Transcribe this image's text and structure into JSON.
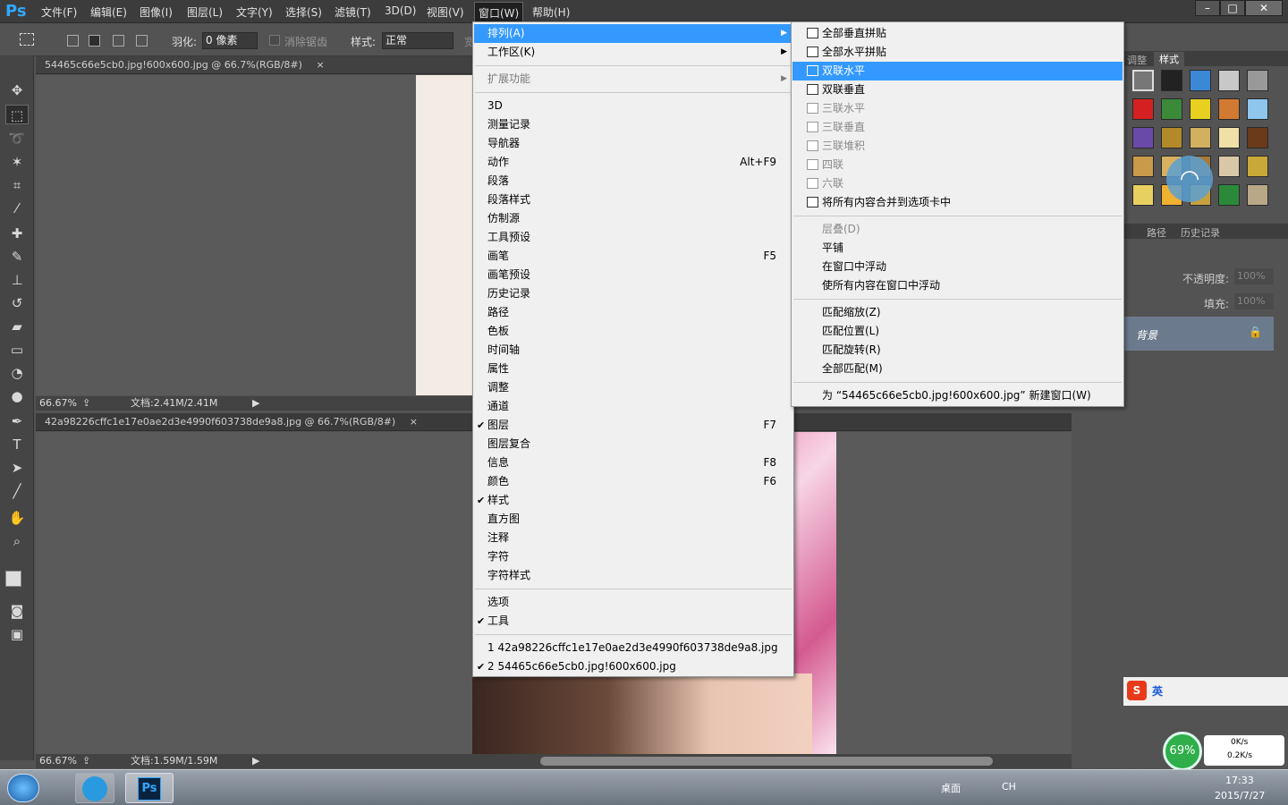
{
  "app": {
    "logo": "Ps"
  },
  "menubar": {
    "items": [
      "文件(F)",
      "编辑(E)",
      "图像(I)",
      "图层(L)",
      "文字(Y)",
      "选择(S)",
      "滤镜(T)",
      "3D(D)",
      "视图(V)",
      "窗口(W)",
      "帮助(H)"
    ],
    "active_index": 9,
    "window_buttons": [
      "–",
      "□",
      "✕"
    ]
  },
  "options": {
    "feather_label": "羽化:",
    "feather_value": "0 像素",
    "antialias_label": "消除锯齿",
    "style_label": "样式:",
    "style_value": "正常",
    "truncated": "宽"
  },
  "doc1": {
    "tab": "54465c66e5cb0.jpg!600x600.jpg @ 66.7%(RGB/8#)",
    "zoom": "66.67%",
    "doc_size": "文档:2.41M/2.41M"
  },
  "doc2": {
    "tab": "42a98226cffc1e17e0ae2d3e4990f603738de9a8.jpg @ 66.7%(RGB/8#)",
    "zoom": "66.67%",
    "doc_size": "文档:1.59M/1.59M"
  },
  "window_menu": [
    {
      "label": "排列(A)",
      "submenu": true,
      "highlight": true
    },
    {
      "label": "工作区(K)",
      "submenu": true
    },
    {
      "sep": true
    },
    {
      "label": "扩展功能",
      "submenu": true,
      "disabled": true
    },
    {
      "sep": true
    },
    {
      "label": "3D"
    },
    {
      "label": "测量记录"
    },
    {
      "label": "导航器"
    },
    {
      "label": "动作",
      "shortcut": "Alt+F9"
    },
    {
      "label": "段落"
    },
    {
      "label": "段落样式"
    },
    {
      "label": "仿制源"
    },
    {
      "label": "工具预设"
    },
    {
      "label": "画笔",
      "shortcut": "F5"
    },
    {
      "label": "画笔预设"
    },
    {
      "label": "历史记录"
    },
    {
      "label": "路径"
    },
    {
      "label": "色板"
    },
    {
      "label": "时间轴"
    },
    {
      "label": "属性"
    },
    {
      "label": "调整"
    },
    {
      "label": "通道"
    },
    {
      "label": "图层",
      "shortcut": "F7",
      "checked": true
    },
    {
      "label": "图层复合"
    },
    {
      "label": "信息",
      "shortcut": "F8"
    },
    {
      "label": "颜色",
      "shortcut": "F6"
    },
    {
      "label": "样式",
      "checked": true
    },
    {
      "label": "直方图"
    },
    {
      "label": "注释"
    },
    {
      "label": "字符"
    },
    {
      "label": "字符样式"
    },
    {
      "sep": true
    },
    {
      "label": "选项"
    },
    {
      "label": "工具",
      "checked": true
    },
    {
      "sep": true
    },
    {
      "label": "1 42a98226cffc1e17e0ae2d3e4990f603738de9a8.jpg"
    },
    {
      "label": "2 54465c66e5cb0.jpg!600x600.jpg",
      "checked": true
    }
  ],
  "arrange_menu": [
    {
      "label": "全部垂直拼贴",
      "icon": true
    },
    {
      "label": "全部水平拼贴",
      "icon": true
    },
    {
      "label": "双联水平",
      "icon": true,
      "highlight": true
    },
    {
      "label": "双联垂直",
      "icon": true
    },
    {
      "label": "三联水平",
      "icon": true,
      "disabled": true
    },
    {
      "label": "三联垂直",
      "icon": true,
      "disabled": true
    },
    {
      "label": "三联堆积",
      "icon": true,
      "disabled": true
    },
    {
      "label": "四联",
      "icon": true,
      "disabled": true
    },
    {
      "label": "六联",
      "icon": true,
      "disabled": true
    },
    {
      "label": "将所有内容合并到选项卡中",
      "icon": true
    },
    {
      "sep": true
    },
    {
      "label": "层叠(D)",
      "disabled": true
    },
    {
      "label": "平铺"
    },
    {
      "label": "在窗口中浮动"
    },
    {
      "label": "使所有内容在窗口中浮动"
    },
    {
      "sep": true
    },
    {
      "label": "匹配缩放(Z)"
    },
    {
      "label": "匹配位置(L)"
    },
    {
      "label": "匹配旋转(R)"
    },
    {
      "label": "全部匹配(M)"
    },
    {
      "sep": true
    },
    {
      "label": "为 “54465c66e5cb0.jpg!600x600.jpg” 新建窗口(W)"
    }
  ],
  "right_panel": {
    "tabs_top": [
      "调整",
      "样式"
    ],
    "tabs_mid": [
      "路径",
      "历史记录"
    ],
    "opacity_label": "不透明度:",
    "opacity_value": "100%",
    "fill_label": "填充:",
    "fill_value": "100%",
    "layer_name": "背景"
  },
  "overlay": {
    "percent": "69%",
    "up": "0K/s",
    "down": "0.2K/s"
  },
  "ime": {
    "lang": "英"
  },
  "taskbar": {
    "desktop": "桌面",
    "lang": "CH",
    "time": "17:33",
    "date": "2015/7/27"
  }
}
